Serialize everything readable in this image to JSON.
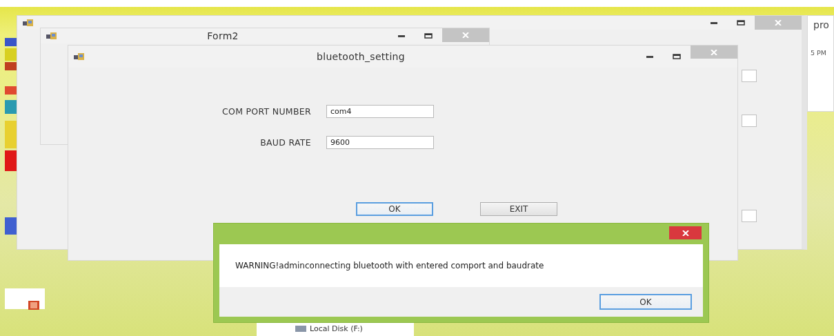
{
  "side_window": {
    "title": "pro",
    "line": "5 PM"
  },
  "form2": {
    "title": "Form2"
  },
  "bluetooth_setting": {
    "title": "bluetooth_setting",
    "fields": [
      {
        "label": "COM PORT NUMBER",
        "value": "com4"
      },
      {
        "label": "BAUD RATE",
        "value": "9600"
      }
    ],
    "buttons": [
      {
        "label": "OK",
        "focused": true
      },
      {
        "label": "EXIT",
        "focused": false
      }
    ]
  },
  "message_box": {
    "message": "WARNING!adminconnecting bluetooth with entered comport and baudrate",
    "buttons": [
      {
        "label": "OK",
        "focused": true
      }
    ]
  },
  "explorer": {
    "items": [
      "Local Disk (F:)"
    ]
  }
}
